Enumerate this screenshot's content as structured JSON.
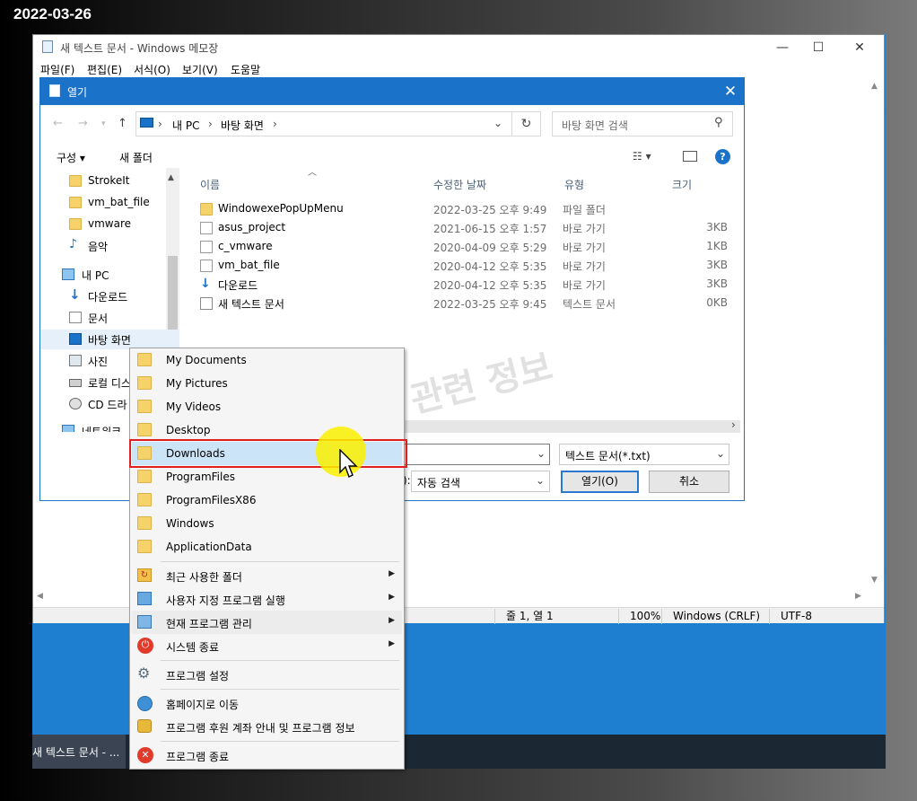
{
  "datestamp": "2022-03-26",
  "taskbar": {
    "item_label": "새 텍스트 문서 - ..."
  },
  "notepad": {
    "title": "새 텍스트 문서 - Windows 메모장",
    "menu": [
      "파일(F)",
      "편집(E)",
      "서식(O)",
      "보기(V)",
      "도움말"
    ],
    "window_buttons": {
      "minimize": "—",
      "maximize": "☐",
      "close": "✕"
    },
    "status": {
      "position": "줄 1, 열 1",
      "zoom": "100%",
      "line_ending": "Windows (CRLF)",
      "encoding": "UTF-8"
    }
  },
  "dialog": {
    "title": "열기",
    "close": "✕",
    "breadcrumb": [
      "내 PC",
      "바탕 화면"
    ],
    "search_placeholder": "바탕 화면 검색",
    "toolbar": {
      "organize": "구성 ▾",
      "new_folder": "새 폴더"
    },
    "tree": [
      {
        "label": "StrokeIt",
        "icon": "folder-icon"
      },
      {
        "label": "vm_bat_file",
        "icon": "folder-icon"
      },
      {
        "label": "vmware",
        "icon": "folder-icon"
      },
      {
        "label": "음악",
        "icon": "music-icon"
      },
      {
        "label": "내 PC",
        "icon": "pc-icon"
      },
      {
        "label": "다운로드",
        "icon": "download-icon"
      },
      {
        "label": "문서",
        "icon": "document-icon"
      },
      {
        "label": "바탕 화면",
        "icon": "desktop-icon"
      },
      {
        "label": "사진",
        "icon": "picture-icon"
      },
      {
        "label": "로컬 디스",
        "icon": "disk-icon"
      },
      {
        "label": "CD 드라",
        "icon": "cd-icon"
      },
      {
        "label": "네트워크",
        "icon": "network-icon"
      }
    ],
    "columns": {
      "name": "이름",
      "date": "수정한 날짜",
      "type": "유형",
      "size": "크기"
    },
    "files": [
      {
        "name": "WindowexePopUpMenu",
        "date": "2022-03-25 오후 9:49",
        "type": "파일 폴더",
        "size": "",
        "icon": "folder-icon"
      },
      {
        "name": "asus_project",
        "date": "2021-06-15 오후 1:57",
        "type": "바로 가기",
        "size": "3KB",
        "icon": "shortcut-icon"
      },
      {
        "name": "c_vmware",
        "date": "2020-04-09 오후 5:29",
        "type": "바로 가기",
        "size": "1KB",
        "icon": "shortcut-icon"
      },
      {
        "name": "vm_bat_file",
        "date": "2020-04-12 오후 5:35",
        "type": "바로 가기",
        "size": "3KB",
        "icon": "shortcut-icon"
      },
      {
        "name": "다운로드",
        "date": "2020-04-12 오후 5:35",
        "type": "바로 가기",
        "size": "3KB",
        "icon": "download-shortcut-icon"
      },
      {
        "name": "새 텍스트 문서",
        "date": "2022-03-25 오후 9:45",
        "type": "텍스트 문서",
        "size": "0KB",
        "icon": "text-doc-icon"
      }
    ],
    "filetype": "텍스트 문서(*.txt)",
    "encoding_label": "):",
    "encoding": "자동 검색",
    "open_button": "열기(O)",
    "cancel_button": "취소"
  },
  "context_menu": {
    "folders": [
      "My Documents",
      "My Pictures",
      "My Videos",
      "Desktop",
      "Downloads",
      "ProgramFiles",
      "ProgramFilesX86",
      "Windows",
      "ApplicationData"
    ],
    "submenus": [
      "최근 사용한 폴더",
      "사용자 지정 프로그램 실행",
      "현재 프로그램 관리",
      "시스템 종료"
    ],
    "settings": "프로그램 설정",
    "homepage": "홈페이지로 이동",
    "donate": "프로그램 후원 계좌 안내 및 프로그램 정보",
    "exit": "프로그램 종료",
    "highlighted": "Downloads"
  },
  "watermark": "컴퓨터 관련 정보",
  "colors": {
    "accent": "#1a73c8",
    "highlight_border": "#e02020",
    "desktop": "#1e7fd1"
  }
}
